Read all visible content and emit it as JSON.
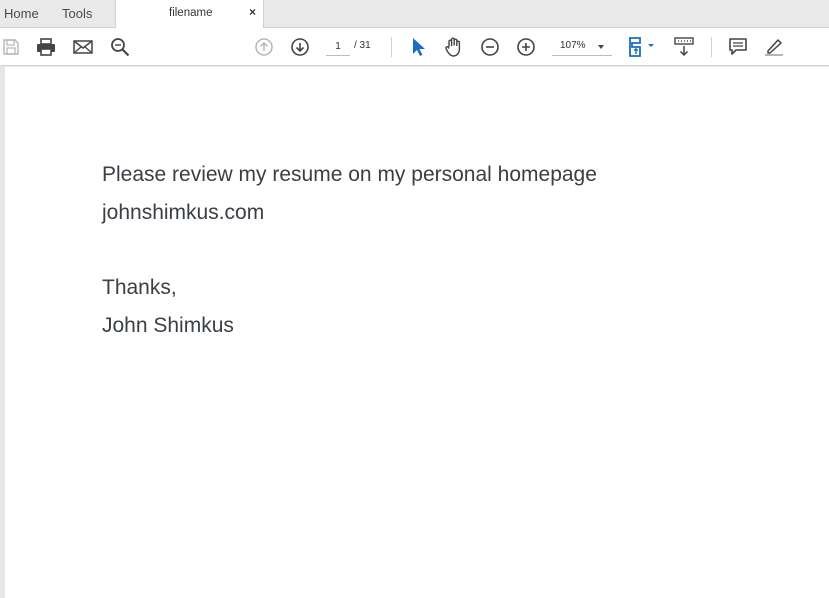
{
  "tabs": {
    "home": "Home",
    "tools": "Tools",
    "document": "filename",
    "close": "×"
  },
  "toolbar": {
    "icons": [
      "save-icon",
      "print-icon",
      "email-icon",
      "find-icon",
      "prev-page-icon",
      "next-page-icon",
      "select-cursor-icon",
      "hand-icon",
      "zoom-out-icon",
      "zoom-in-icon",
      "page-layout-icon",
      "keyboard-scroll-icon",
      "comment-icon",
      "highlight-icon"
    ],
    "page_current": "1",
    "page_total": "/ 31",
    "zoom": "107%"
  },
  "document": {
    "lines": [
      "Please review my resume on my personal homepage",
      "johnshimkus.com",
      "Thanks,",
      "John Shimkus"
    ]
  },
  "colors": {
    "accent_blue": "#1a6fc1",
    "icon_gray": "#444444",
    "disabled_gray": "#b5b5b5",
    "text": "#3a3f46"
  }
}
